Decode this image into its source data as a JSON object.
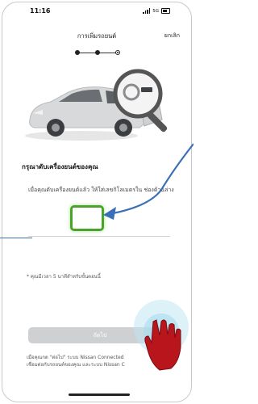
{
  "status_bar": {
    "time": "11:16",
    "network": "5G"
  },
  "header": {
    "title": "การเพิ่มรถยนต์",
    "cancel_label": "ยกเลิก"
  },
  "steps": {
    "total": 3,
    "current": 3
  },
  "content": {
    "instruction_title": "กรุณาดับเครื่องยนต์ของคุณ",
    "instruction_body": "เมื่อคุณดับเครื่องยนต์แล้ว ให้ใส่เลขกิโลเมตรใน ช่องด้านล่าง",
    "odometer_value": "",
    "note": "* คุณมีเวลา 5 นาทีสำหรับขั้นตอนนี้"
  },
  "next_button": {
    "label": "ถัดไป"
  },
  "footer": {
    "text_line1": "เมื่อคุณกด \"ต่อไป\" ระบบ Nissan Connected",
    "text_line2": "เชื่อมต่อกับรถยนต์ของคุณ และระบบ Nissan C"
  },
  "colors": {
    "highlight_green": "#4aa32a",
    "arrow_blue": "#3a6fb8",
    "tap_hand_red": "#b8161c",
    "button_disabled": "#cfd0d2"
  },
  "icons": {
    "magnifier": "search-magnifier-icon",
    "tap_hand": "hand-pointer-icon",
    "arrow": "pointer-arrow-icon"
  }
}
